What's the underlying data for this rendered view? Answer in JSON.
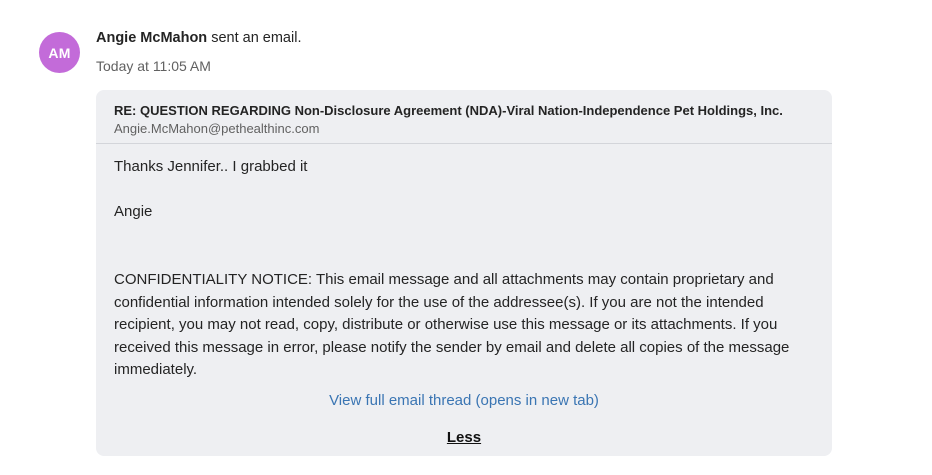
{
  "activity": {
    "avatar_initials": "AM",
    "avatar_color": "#c36bd9",
    "sender_name": "Angie McMahon",
    "action_text": " sent an email.",
    "timestamp": "Today at 11:05 AM"
  },
  "email": {
    "subject": "RE: QUESTION REGARDING Non-Disclosure Agreement (NDA)-Viral Nation-Independence Pet Holdings, Inc.",
    "from_address": "Angie.McMahon@pethealthinc.com",
    "body_line1": "Thanks Jennifer.. I grabbed it",
    "body_signature": "Angie",
    "confidentiality_notice": "CONFIDENTIALITY NOTICE: This email message and all attachments may contain proprietary and confidential information intended solely for the use of the addressee(s). If you are not the intended recipient, you may not read, copy, distribute or otherwise use this message or its attachments. If you received this message in error, please notify the sender by email and delete all copies of the message immediately.",
    "view_thread_label": "View full email thread (opens in new tab)",
    "less_label": "Less"
  },
  "colors": {
    "card_background": "#eeeff2",
    "link": "#3a75b3"
  }
}
